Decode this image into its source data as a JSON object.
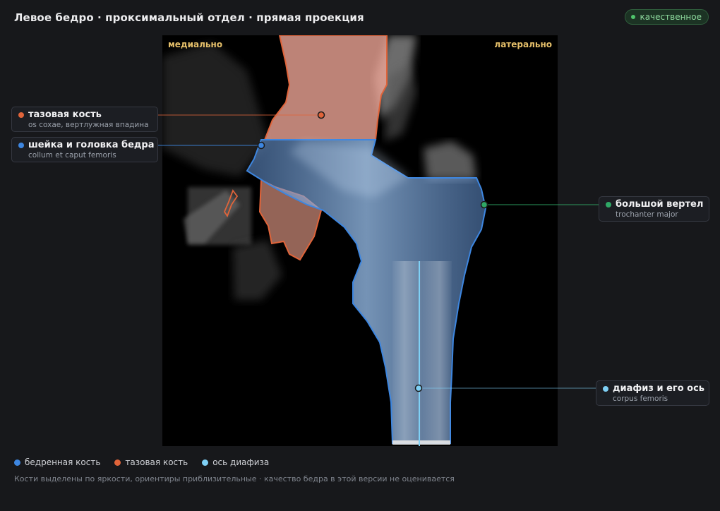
{
  "header": {
    "title": "Левое бедро · проксимальный отдел · прямая проекция",
    "badge": "качественное"
  },
  "viewer": {
    "orientation_left": "медиально",
    "orientation_right": "латерально"
  },
  "callouts": {
    "pelvis": {
      "name": "тазовая кость",
      "latin": "os coxae, вертлужная впадина",
      "color": "#e0643a"
    },
    "neck": {
      "name": "шейка и головка бедра",
      "latin": "collum et caput femoris",
      "color": "#3d86e0"
    },
    "trochanter": {
      "name": "большой вертел",
      "latin": "trochanter major",
      "color": "#2fa866"
    },
    "shaft": {
      "name": "диафиз и его ось",
      "latin": "corpus femoris",
      "color": "#7fd0f5"
    }
  },
  "legend": [
    {
      "label": "бедренная кость",
      "color": "#3d86e0"
    },
    {
      "label": "тазовая кость",
      "color": "#e0643a"
    },
    {
      "label": "ось диафиза",
      "color": "#7fd0f5"
    }
  ],
  "footnote": "Кости выделены по яркости, ориентиры приблизительные · качество бедра в этой версии не оценивается"
}
